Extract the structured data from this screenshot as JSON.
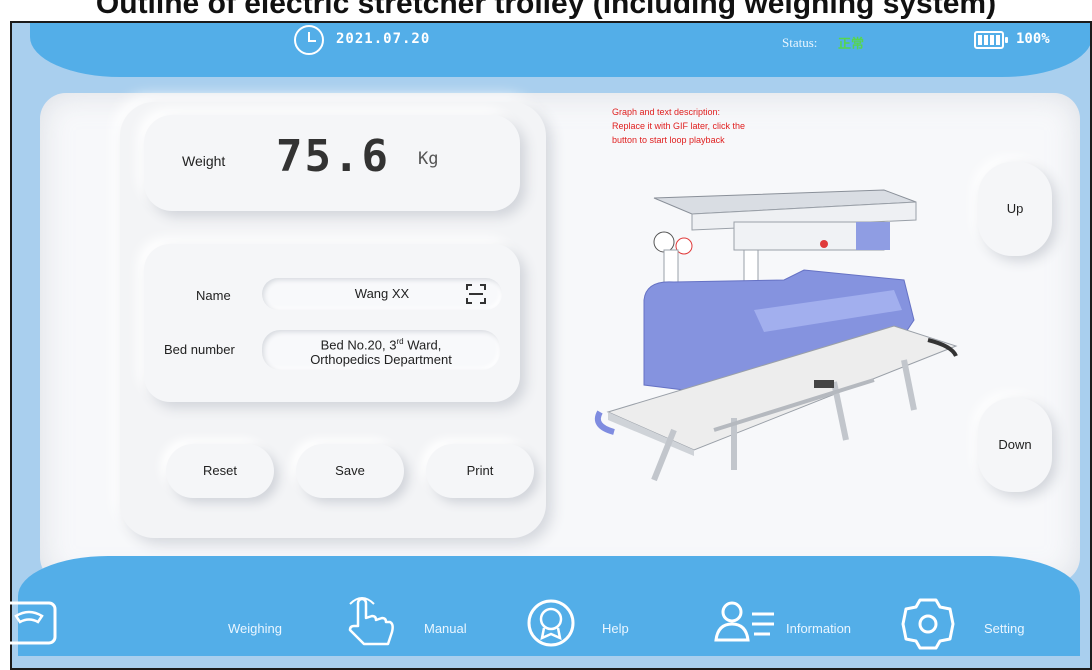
{
  "caption": "Outline of electric stretcher trolley (including weighing system)",
  "header": {
    "date": "2021.07.20",
    "status_label": "Status:",
    "status_value": "正常",
    "battery": "100%"
  },
  "weight": {
    "label": "Weight",
    "value": "75.6",
    "unit": "Kg"
  },
  "patient": {
    "name_label": "Name",
    "name_value": "Wang XX",
    "bed_label": "Bed number",
    "bed_value_line1": "Bed No.20, 3",
    "bed_value_sup": "rd",
    "bed_value_line1b": " Ward,",
    "bed_value_line2": "Orthopedics Department"
  },
  "actions": {
    "reset": "Reset",
    "save": "Save",
    "print": "Print"
  },
  "illustration_note": {
    "line1": "Graph and text description:",
    "line2": "Replace it with GIF later, click the",
    "line3": "button to start loop playback"
  },
  "controls": {
    "up": "Up",
    "down": "Down"
  },
  "nav": [
    {
      "label": "Weighing",
      "icon": "scale-icon"
    },
    {
      "label": "Manual",
      "icon": "hand-pointer-icon"
    },
    {
      "label": "Help",
      "icon": "help-badge-icon"
    },
    {
      "label": "Information",
      "icon": "user-list-icon"
    },
    {
      "label": "Setting",
      "icon": "gear-icon"
    }
  ],
  "colors": {
    "bar_blue": "#53aee8",
    "side_blue": "#a9cfee",
    "status_ok": "#56d64f",
    "note_red": "#e02020"
  }
}
